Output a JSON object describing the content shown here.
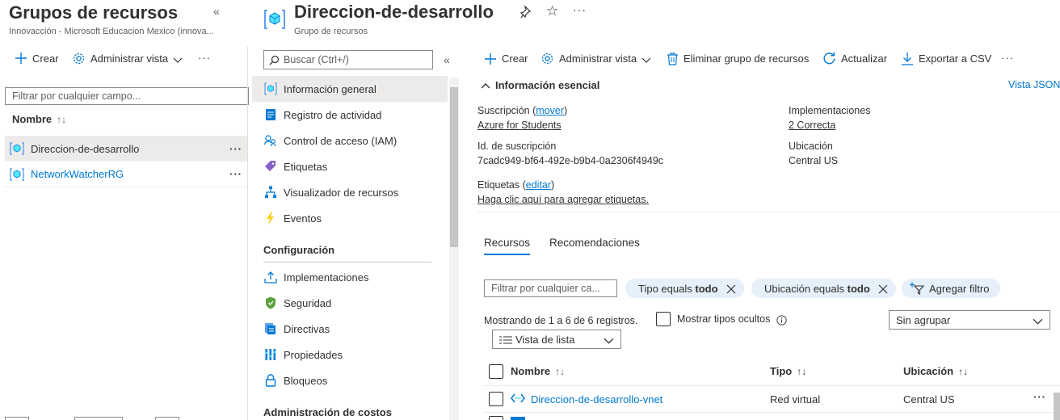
{
  "left_panel": {
    "title": "Grupos de recursos",
    "subtitle": "Innovacción - Microsoft Educacion Mexico (innova...",
    "collapse_glyph": "«",
    "commands": {
      "create": "Crear",
      "manage_view": "Administrar vista",
      "more": "···"
    },
    "filter_placeholder": "Filtrar por cualquier campo...",
    "column_name": "Nombre",
    "items": [
      {
        "name": "Direccion-de-desarrollo",
        "icon": "resource-group-icon",
        "selected": true
      },
      {
        "name": "NetworkWatcherRG",
        "icon": "resource-group-icon",
        "selected": false
      }
    ]
  },
  "header": {
    "title": "Direccion-de-desarrollo",
    "subtitle": "Grupo de recursos"
  },
  "nav": {
    "search_placeholder": "Buscar (Ctrl+/)",
    "collapse_glyph": "«",
    "items": [
      {
        "label": "Información general",
        "icon": "cube-icon",
        "selected": true
      },
      {
        "label": "Registro de actividad",
        "icon": "activity-log-icon"
      },
      {
        "label": "Control de acceso (IAM)",
        "icon": "people-icon"
      },
      {
        "label": "Etiquetas",
        "icon": "tag-icon"
      },
      {
        "label": "Visualizador de recursos",
        "icon": "hierarchy-icon"
      },
      {
        "label": "Eventos",
        "icon": "lightning-icon"
      }
    ],
    "section_config": "Configuración",
    "config_items": [
      {
        "label": "Implementaciones",
        "icon": "upload-icon"
      },
      {
        "label": "Seguridad",
        "icon": "shield-icon"
      },
      {
        "label": "Directivas",
        "icon": "policy-icon"
      },
      {
        "label": "Propiedades",
        "icon": "properties-icon"
      },
      {
        "label": "Bloqueos",
        "icon": "lock-icon"
      }
    ],
    "section_costs": "Administración de costos"
  },
  "toolbar": {
    "create": "Crear",
    "manage_view": "Administrar vista",
    "delete_group": "Eliminar grupo de recursos",
    "refresh": "Actualizar",
    "export_csv": "Exportar a CSV",
    "more": "···"
  },
  "essentials": {
    "heading": "Información esencial",
    "json_view": "Vista JSON",
    "subscription_label": "Suscripción",
    "subscription_move": "mover",
    "subscription_value": "Azure for Students",
    "subscription_id_label": "Id. de suscripción",
    "subscription_id_value": "7cadc949-bf64-492e-b9b4-0a2306f4949c",
    "tags_label": "Etiquetas",
    "tags_edit": "editar",
    "tags_add": "Haga clic aquí para agregar etiquetas.",
    "deployments_label": "Implementaciones",
    "deployments_value": "2 Correcta",
    "location_label": "Ubicación",
    "location_value": "Central US"
  },
  "tabs": {
    "resources": "Recursos",
    "recommendations": "Recomendaciones"
  },
  "filters": {
    "placeholder": "Filtrar por cualquier ca...",
    "type_pill_prefix": "Tipo equals",
    "type_pill_value": "todo",
    "location_pill_prefix": "Ubicación equals",
    "location_pill_value": "todo",
    "add_filter": "Agregar filtro"
  },
  "results": {
    "showing": "Mostrando de 1 a 6 de 6 registros.",
    "show_hidden": "Mostrar tipos ocultos",
    "group_by": "Sin agrupar",
    "view_mode": "Vista de lista"
  },
  "table": {
    "col_name": "Nombre",
    "col_type": "Tipo",
    "col_location": "Ubicación",
    "rows": [
      {
        "name": "Direccion-de-desarrollo-vnet",
        "type": "Red virtual",
        "location": "Central US",
        "icon": "vnet-icon"
      }
    ]
  },
  "colors": {
    "accent": "#0078d4",
    "selected_bg": "#edebe9",
    "pill_bg": "#e6f0fa"
  }
}
